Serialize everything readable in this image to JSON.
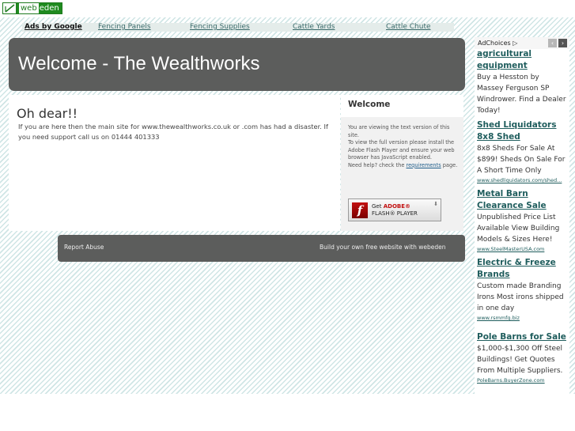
{
  "brand": {
    "logo_text": "webeden",
    "logo_prefix": "web",
    "logo_suffix": "eden"
  },
  "adlinks": {
    "label": "Ads by Google",
    "items": [
      "Fencing Panels",
      "Fencing Supplies",
      "Cattle Yards",
      "Cattle Chute"
    ]
  },
  "header": {
    "title": "Welcome - The Wealthworks"
  },
  "main": {
    "heading": "Oh dear!!",
    "text": "If you are here then the main site for www.thewealthworks.co.uk or .com has had a disaster. If you need support call us on 01444 401333"
  },
  "side": {
    "heading": "Welcome",
    "info_1": "You are viewing the text version of this site.",
    "info_2": "To view the full version please install the Adobe Flash Player and ensure your web browser has JavaScript enabled.",
    "info_3a": "Need help? check the",
    "info_3_link": "requirements",
    "info_3b": "page.",
    "flash": {
      "line1a": "Get",
      "line1b": "ADOBE®",
      "line2": "FLASH® PLAYER"
    }
  },
  "footer": {
    "report": "Report Abuse",
    "build": "Build your own free website with webeden"
  },
  "ads": {
    "choices": "AdChoices",
    "items": [
      {
        "title": "agricultural equipment",
        "body": "Buy a Hesston by Massey Ferguson SP Windrower. Find a Dealer Today!",
        "url": ""
      },
      {
        "title": "Shed Liquidators 8x8 Shed",
        "body": "8x8 Sheds For Sale At $899! Sheds On Sale For A Short Time Only",
        "url": "www.shedliquidators.com/shed..."
      },
      {
        "title": "Metal Barn Clearance Sale",
        "body": "Unpublished Price List Available View Building Models & Sizes Here!",
        "url": "www.SteelMasterUSA.com"
      },
      {
        "title": "Electric & Freeze Brands",
        "body": "Custom made Branding Irons Most irons shipped in one day",
        "url": "www.rsmmfg.biz"
      },
      {
        "title": "Pole Barns for Sale",
        "body": "$1,000-$1,300 Off Steel Buildings! Get Quotes From Multiple Suppliers.",
        "url": "PoleBarns.BuyerZone.com"
      }
    ]
  },
  "colors": {
    "header_bg": "#5c5d5c",
    "ad_link": "#1f5d5d",
    "hatch": "#cfe5e5"
  }
}
